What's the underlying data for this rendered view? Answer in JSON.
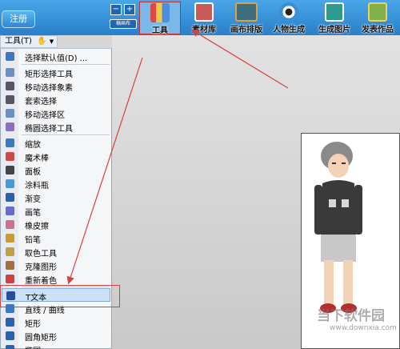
{
  "toolbar": {
    "register_label": "注册",
    "canvas_size_label": "稿画布",
    "canvas_buttons": [
      "−",
      "+"
    ],
    "tools": [
      {
        "label": "工具",
        "icon": "tools-icon",
        "color": "#e04848"
      },
      {
        "label": "素材库",
        "icon": "library-icon",
        "color": "#c85a5a"
      },
      {
        "label": "画布排版",
        "icon": "layout-icon",
        "color": "#3d6e7e"
      },
      {
        "label": "人物生成",
        "icon": "eye-icon",
        "color": "#3c8fd0"
      },
      {
        "label": "生成图片",
        "icon": "image-icon",
        "color": "#2f9a8e"
      },
      {
        "label": "发表作品",
        "icon": "publish-icon",
        "color": "#7fb04a"
      }
    ]
  },
  "menu": {
    "title": "工具(T)",
    "items": [
      {
        "label": "选择默认值(D) ...",
        "icon": "default-select-icon",
        "color": "#3a78c2"
      },
      {
        "label": "矩形选择工具",
        "icon": "rect-select-icon",
        "color": "#6a8fc0"
      },
      {
        "label": "移动选择象素",
        "icon": "move-pixels-icon",
        "color": "#556"
      },
      {
        "label": "套索选择",
        "icon": "lasso-icon",
        "color": "#556"
      },
      {
        "label": "移动选择区",
        "icon": "move-selection-icon",
        "color": "#6a8fc0"
      },
      {
        "label": "椭圆选择工具",
        "icon": "ellipse-select-icon",
        "color": "#8a6fc0"
      },
      {
        "label": "缩放",
        "icon": "zoom-icon",
        "color": "#3a78c2"
      },
      {
        "label": "魔术棒",
        "icon": "magic-wand-icon",
        "color": "#d04848"
      },
      {
        "label": "面板",
        "icon": "hand-icon",
        "color": "#444"
      },
      {
        "label": "涂料瓶",
        "icon": "paint-bucket-icon",
        "color": "#4a9ad0"
      },
      {
        "label": "渐变",
        "icon": "gradient-icon",
        "color": "#2b5fb0"
      },
      {
        "label": "画笔",
        "icon": "brush-icon",
        "color": "#6a6ad0"
      },
      {
        "label": "橡皮擦",
        "icon": "eraser-icon",
        "color": "#d07090"
      },
      {
        "label": "铅笔",
        "icon": "pencil-icon",
        "color": "#c89a30"
      },
      {
        "label": "取色工具",
        "icon": "color-picker-icon",
        "color": "#c0a040"
      },
      {
        "label": "克隆图形",
        "icon": "clone-stamp-icon",
        "color": "#a07040"
      },
      {
        "label": "重新着色",
        "icon": "recolor-icon",
        "color": "#d04040"
      },
      {
        "label": "T文本",
        "icon": "text-icon",
        "color": "#2a4a9a"
      },
      {
        "label": "直线 / 曲线",
        "icon": "line-curve-icon",
        "color": "#3a78c2"
      },
      {
        "label": "矩形",
        "icon": "rectangle-icon",
        "color": "#2b5fb0"
      },
      {
        "label": "圆角矩形",
        "icon": "rounded-rectangle-icon",
        "color": "#2b5fb0"
      },
      {
        "label": "椭圆",
        "icon": "ellipse-icon",
        "color": "#2b5fb0"
      }
    ]
  },
  "watermark": {
    "text": "当下软件园",
    "url": "www.downxia.com"
  },
  "colors": {
    "toolbar_blue": "#2a7fc8",
    "annotation_red": "#d84040",
    "selection_blue": "#cbe1f7"
  }
}
